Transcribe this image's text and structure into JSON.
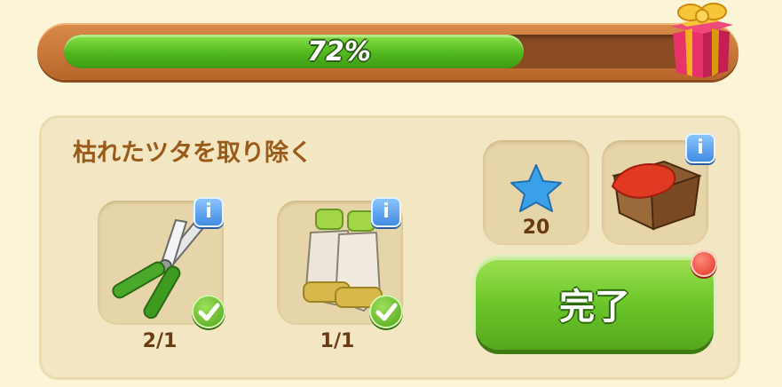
{
  "progress": {
    "percent": 72,
    "label": "72%"
  },
  "quest": {
    "title": "枯れたツタを取り除く"
  },
  "required_items": [
    {
      "name": "pruning-shears",
      "count": "2/1",
      "info": "i"
    },
    {
      "name": "garden-gloves",
      "count": "1/1",
      "info": "i"
    }
  ],
  "rewards": [
    {
      "name": "blue-star",
      "amount": "20"
    },
    {
      "name": "wooden-crate",
      "info": "i"
    }
  ],
  "action": {
    "complete_label": "完了"
  },
  "colors": {
    "progress_fill": "#4fb81e",
    "title_text": "#9a5a1a",
    "complete_button": "#6cc62a"
  }
}
